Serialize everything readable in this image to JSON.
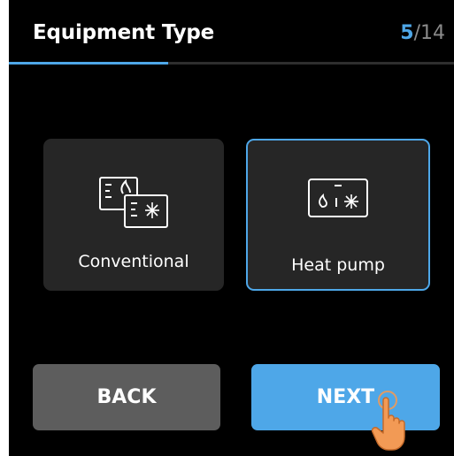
{
  "header": {
    "title": "Equipment Type",
    "step_current": "5",
    "step_separator": "/",
    "step_total": "14",
    "progress_fraction": 0.357
  },
  "options": {
    "conventional": {
      "label": "Conventional",
      "icon": "conventional-furnace-ac-icon",
      "selected": false
    },
    "heat_pump": {
      "label": "Heat pump",
      "icon": "heat-pump-icon",
      "selected": true
    }
  },
  "buttons": {
    "back_label": "BACK",
    "next_label": "NEXT"
  },
  "pointer": {
    "icon": "tap-hand-icon"
  },
  "colors": {
    "accent": "#4ea7e8",
    "background": "#000000",
    "card": "#262626",
    "back_button": "#5d5d5d",
    "hand": "#f29a55"
  }
}
